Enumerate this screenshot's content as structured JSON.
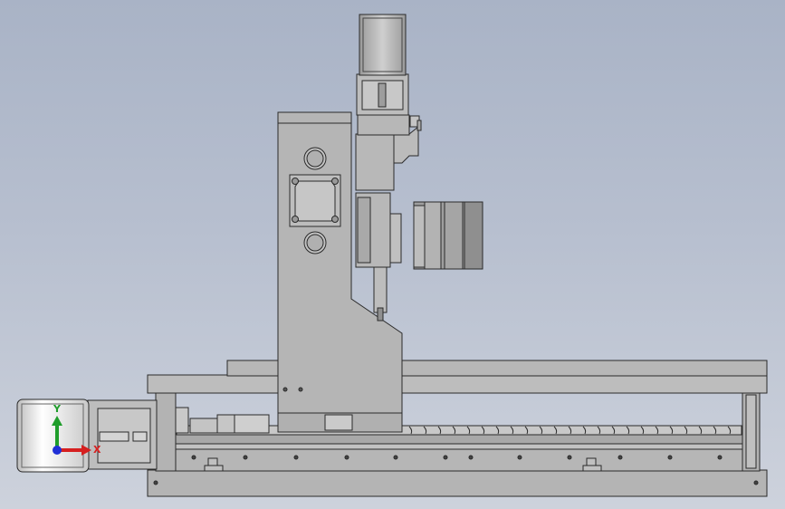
{
  "viewport": {
    "background_top": "#a9b3c6",
    "background_bottom": "#cdd2dc"
  },
  "model": {
    "body_color": "#b9b9b9",
    "edge_color": "#2a2a2a",
    "shadow_color": "#8e8e8e"
  },
  "triad": {
    "x_axis_label": "X",
    "y_axis_label": "Y",
    "x_axis_color": "#d62020",
    "y_axis_color": "#1f9d2b",
    "z_axis_color": "#1f2fd6"
  }
}
